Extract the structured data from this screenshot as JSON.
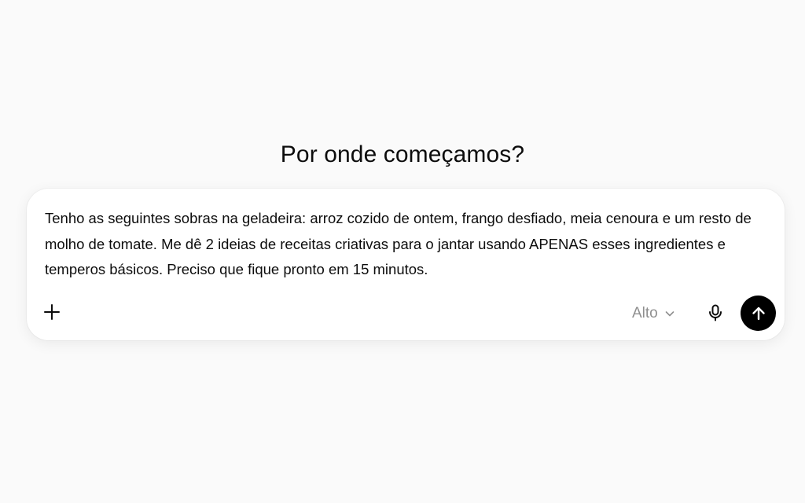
{
  "heading": "Por onde começamos?",
  "composer": {
    "prompt_text": "Tenho as seguintes sobras na geladeira: arroz cozido de ontem, frango desfiado, meia cenoura e um resto de molho de tomate. Me dê 2 ideias de receitas criativas para o jantar usando APENAS esses ingredientes e temperos básicos. Preciso que fique pronto em 15 minutos.",
    "model_label": "Alto",
    "icons": {
      "attach": "plus-icon",
      "model_dropdown": "chevron-down-icon",
      "voice": "microphone-icon",
      "send": "arrow-up-icon"
    }
  },
  "colors": {
    "page_background": "#fafafa",
    "composer_background": "#ffffff",
    "send_button": "#000000",
    "muted_text": "#8f8f8f"
  }
}
